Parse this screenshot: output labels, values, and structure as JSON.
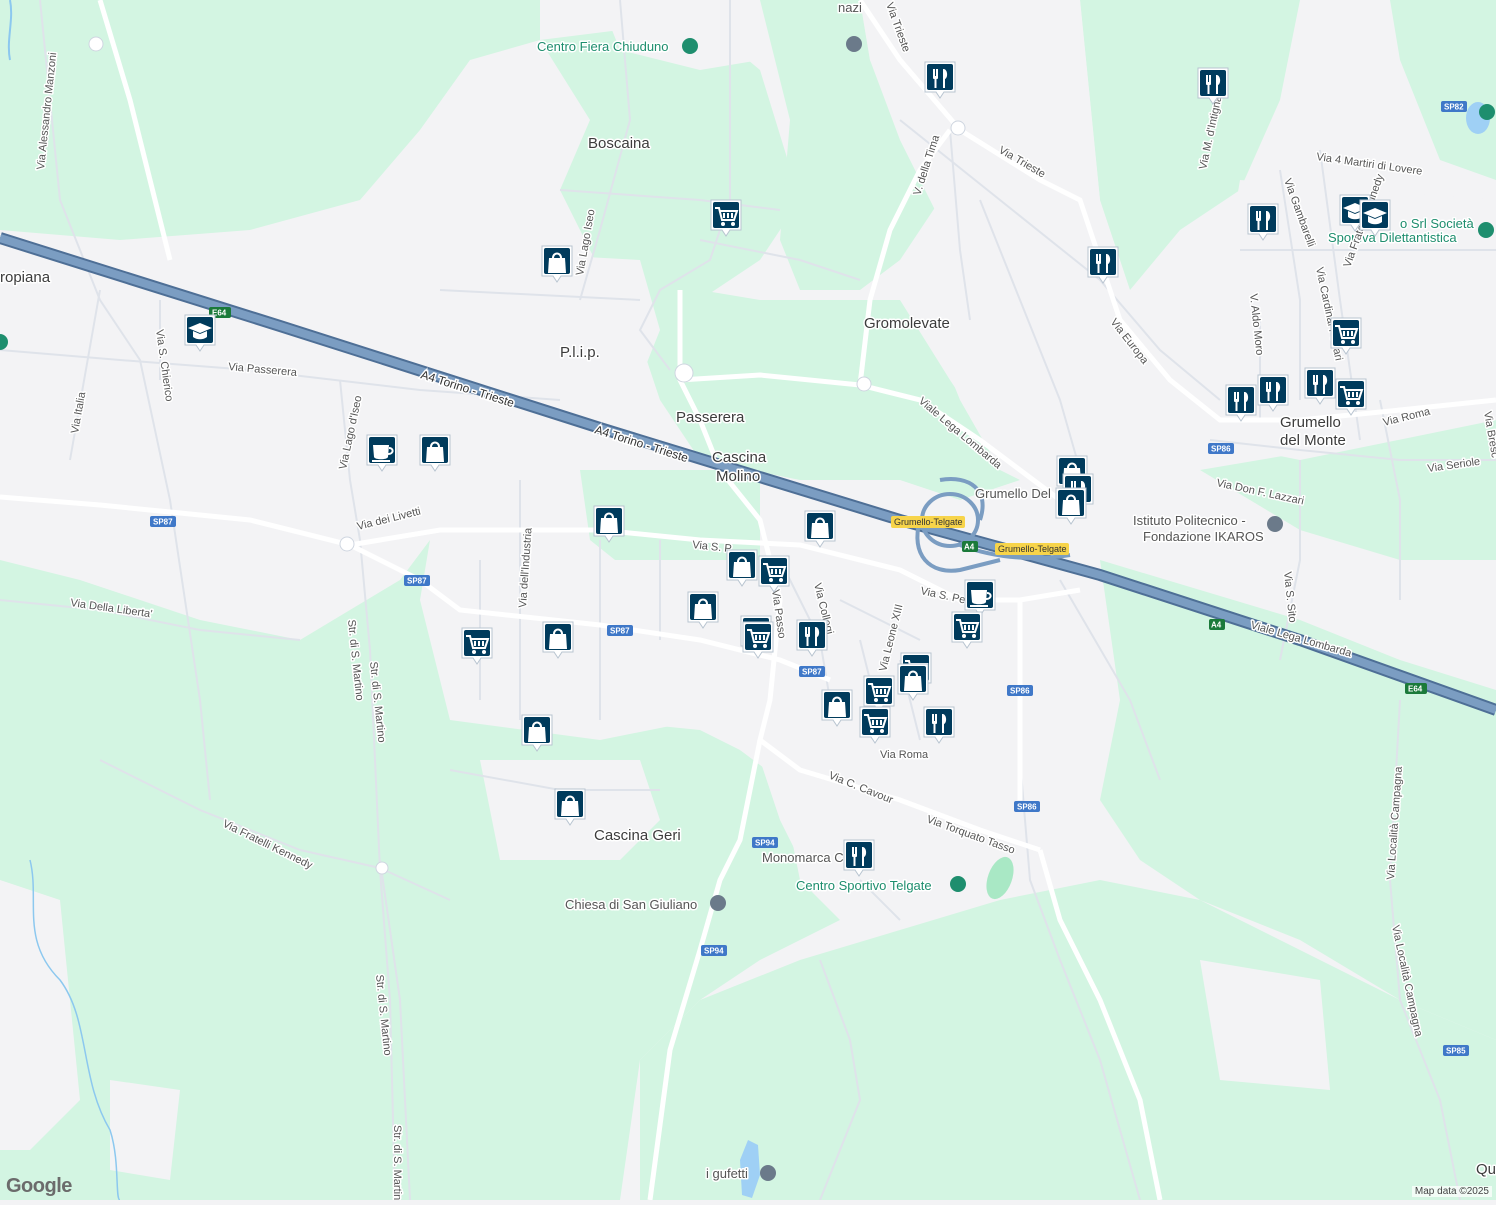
{
  "map": {
    "attribution": "Map data ©2025",
    "logo": "Google",
    "colors": {
      "background": "#f3f3f5",
      "green": "#d3f5e2",
      "highway": "#6c8db2",
      "road": "#dfe3ea",
      "water": "#9fd0f5",
      "marker": "#003b5c"
    },
    "places": {
      "boscaina": "Boscaina",
      "plip": "P.l.i.p.",
      "passerera": "Passerera",
      "cascina_molino_1": "Cascina",
      "cascina_molino_2": "Molino",
      "gromolevate": "Gromolevate",
      "grumello_1": "Grumello",
      "grumello_2": "del Monte",
      "cascina_geri": "Cascina Geri",
      "europiana": "ropiana",
      "qu": "Qu"
    },
    "pois": {
      "fiera": "Centro Fiera Chiuduno",
      "ikaros_1": "Istituto Politecnico -",
      "ikaros_2": "Fondazione IKAROS",
      "srl_1": "o Srl Società",
      "srl_2": "Sportiva Dilettantistica",
      "grumello_del": "Grumello Del",
      "monomarca": "Monomarca Cam",
      "centro_sportivo": "Centro Sportivo Telgate",
      "chiesa": "Chiesa di San Giuliano",
      "gufetti": "i gufetti",
      "manzi": "nazi"
    },
    "streets": {
      "a4_1": "A4 Torino - Trieste",
      "a4_2": "A4 Torino - Trieste",
      "via_trieste_1": "Via Trieste",
      "via_trieste_2": "Via Trieste",
      "via_tima": "V. della Tima",
      "via_europa": "Via Europa",
      "viale_lega_1": "Viale Lega Lombarda",
      "viale_lega_2": "Viale Lega Lombarda",
      "via_roma_1": "Via Roma",
      "via_roma_2": "Via Roma",
      "via_seriole": "Via Seriole",
      "via_lazzari": "Via Don F. Lazzari",
      "via_manzoni": "Via Alessandro Manzoni",
      "via_chierico": "Via S. Chierico",
      "via_italia": "Via Italia",
      "via_passerera": "Via Passerera",
      "via_lago_iseo_1": "Via Lago d'Iseo",
      "via_lago_iseo_2": "Via Lago Iseo",
      "via_livetti": "Via dei Livetti",
      "via_industria": "Via dell'Industria",
      "via_liberta": "Via Della Liberta'",
      "str_martino_1": "Str. di S. Martino",
      "str_martino_2": "Str. di S. Martino",
      "str_martino_3": "Str. di S. Martino",
      "str_martino_4": "Str. di S. Martino",
      "via_kennedy": "Via Fratelli Kennedy",
      "via_cavour": "Via C. Cavour",
      "via_tasso": "Via Torquato Tasso",
      "via_leone": "Via Leone XIII",
      "via_collegi": "Via Collegi",
      "via_passo": "Via Passo",
      "via_s_pietro": "Via S. Pe",
      "via_s_p": "Via S. P",
      "via_4_martiri": "Via 4 Martiri di Lovere",
      "via_gambarelli": "Via Gambarelli",
      "via_aldo_moro": "V. Aldo Moro",
      "via_ferrari": "Via Cardinal Ferrari",
      "via_kennedy_2": "Via Fratelli Kennedy",
      "via_intignano": "Via M. d'Intignano",
      "via_sito": "Via S. Sito",
      "via_campagna_1": "Via Località Campagna",
      "via_campagna_2": "Via Località Campagna",
      "via_bresc": "Via Bresc"
    },
    "shields": {
      "sp87_1": "SP87",
      "sp87_2": "SP87",
      "sp87_3": "SP87",
      "sp87_4": "SP87",
      "sp86_1": "SP86",
      "sp86_2": "SP86",
      "sp86_3": "SP86",
      "sp94_1": "SP94",
      "sp94_2": "SP94",
      "sp82": "SP82",
      "sp85": "SP85",
      "e64_1": "E64",
      "e64_2": "E64",
      "a4_1": "A4",
      "a4_2": "A4",
      "exit_1": "Grumello-Telgate",
      "exit_2": "Grumello-Telgate"
    },
    "markers": [
      {
        "type": "restaurant",
        "icon": "restaurant-icon"
      },
      {
        "type": "restaurant",
        "icon": "restaurant-icon"
      },
      {
        "type": "grocery",
        "icon": "shopping-cart-icon"
      },
      {
        "type": "school",
        "icon": "graduation-cap-icon"
      },
      {
        "type": "school",
        "icon": "graduation-cap-icon"
      },
      {
        "type": "restaurant",
        "icon": "restaurant-icon"
      },
      {
        "type": "shopping",
        "icon": "shopping-bag-icon"
      },
      {
        "type": "restaurant",
        "icon": "restaurant-icon"
      },
      {
        "type": "school",
        "icon": "graduation-cap-icon"
      },
      {
        "type": "grocery",
        "icon": "shopping-cart-icon"
      },
      {
        "type": "cafe",
        "icon": "coffee-cup-icon"
      },
      {
        "type": "shopping",
        "icon": "shopping-bag-icon"
      },
      {
        "type": "restaurant",
        "icon": "restaurant-icon"
      },
      {
        "type": "restaurant",
        "icon": "restaurant-icon"
      },
      {
        "type": "restaurant",
        "icon": "restaurant-icon"
      },
      {
        "type": "grocery",
        "icon": "shopping-cart-icon"
      },
      {
        "type": "shopping",
        "icon": "shopping-bag-icon"
      },
      {
        "type": "restaurant",
        "icon": "restaurant-icon"
      },
      {
        "type": "shopping",
        "icon": "shopping-bag-icon"
      },
      {
        "type": "shopping",
        "icon": "shopping-bag-icon"
      },
      {
        "type": "shopping",
        "icon": "shopping-bag-icon"
      },
      {
        "type": "shopping",
        "icon": "shopping-bag-icon"
      },
      {
        "type": "grocery",
        "icon": "shopping-cart-icon"
      },
      {
        "type": "cafe",
        "icon": "coffee-cup-icon"
      },
      {
        "type": "grocery",
        "icon": "shopping-cart-icon"
      },
      {
        "type": "shopping",
        "icon": "shopping-bag-icon"
      },
      {
        "type": "grocery",
        "icon": "shopping-cart-icon"
      },
      {
        "type": "grocery",
        "icon": "shopping-cart-icon"
      },
      {
        "type": "restaurant",
        "icon": "restaurant-icon"
      },
      {
        "type": "shopping",
        "icon": "shopping-bag-icon"
      },
      {
        "type": "grocery",
        "icon": "shopping-cart-icon"
      },
      {
        "type": "grocery",
        "icon": "shopping-cart-icon"
      },
      {
        "type": "shopping",
        "icon": "shopping-bag-icon"
      },
      {
        "type": "grocery",
        "icon": "shopping-cart-icon"
      },
      {
        "type": "grocery",
        "icon": "shopping-cart-icon"
      },
      {
        "type": "restaurant",
        "icon": "restaurant-icon"
      },
      {
        "type": "shopping",
        "icon": "shopping-bag-icon"
      },
      {
        "type": "shopping",
        "icon": "shopping-bag-icon"
      },
      {
        "type": "shopping",
        "icon": "shopping-bag-icon"
      },
      {
        "type": "restaurant",
        "icon": "restaurant-icon"
      }
    ]
  }
}
